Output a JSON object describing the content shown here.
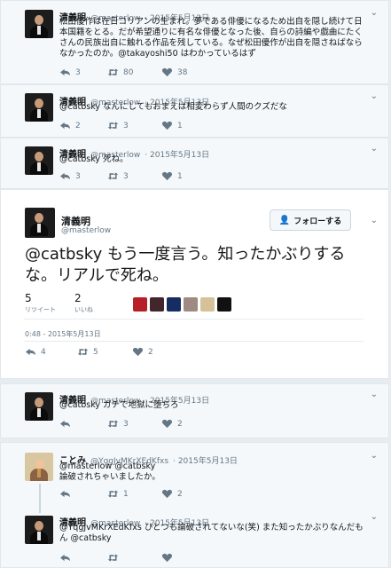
{
  "tweets": [
    {
      "name": "清義明",
      "handle": "@masterlow",
      "time": "· 2015年5月12日",
      "text": [
        "松田優作は在日コリアンの生まれ。夢である俳優になるため出自を隠し続けて日",
        "本国籍をとる。だが希望通りに有名な俳優となった後、自らの詩編や戯曲にたく",
        "さんの民族出自に触れる作品を残している。なぜ松田優作が出自を隠さねばなら",
        "なかったのか。@takayoshi50 はわかっているはず"
      ],
      "reply_count": "3",
      "retweet_count": "80",
      "like_count": "38"
    },
    {
      "name": "清義明",
      "handle": "@masterlow",
      "time": "· 2015年5月13日",
      "text": [
        "@catbsky なんにしてもおまえは相変わらず人間のクズだな"
      ],
      "reply_count": "2",
      "retweet_count": "3",
      "like_count": "1"
    },
    {
      "name": "清義明",
      "handle": "@masterlow",
      "time": "· 2015年5月13日",
      "text": [
        "@catbsky 死ね。"
      ],
      "reply_count": "3",
      "retweet_count": "3",
      "like_count": "1"
    }
  ],
  "main": {
    "name": "清義明",
    "handle": "@masterlow",
    "follow_label": "フォローする",
    "text": "@catbsky もう一度言う。知ったかぶりするな。リアルで死ね。",
    "retweets_num": "5",
    "retweets_label": "リツイート",
    "likes_num": "2",
    "likes_label": "いいね",
    "date": "0:48 - 2015年5月13日",
    "reply_count": "4",
    "retweet_count": "5",
    "like_count": "2"
  },
  "replies": [
    {
      "name": "清義明",
      "handle": "@masterlow",
      "time": "· 2015年5月13日",
      "text": [
        "@catbsky ガチで地獄に堕ちろ"
      ],
      "reply_count": "",
      "retweet_count": "3",
      "like_count": "2"
    },
    {
      "name": "ことみ",
      "handle": "@YqgJvMKrXEdKfxs",
      "time": "· 2015年5月13日",
      "text": [
        "@masterlow @catbsky",
        "論破されちゃいましたか。"
      ],
      "reply_count": "",
      "retweet_count": "1",
      "like_count": "2"
    },
    {
      "name": "清義明",
      "handle": "@masterlow",
      "time": "· 2015年5月13日",
      "text": [
        "@YqgJvMKrXEdKfxs ひとつも論破されてないな(笑) また知ったかぶりなんだも",
        "ん @catbsky"
      ],
      "reply_count": "",
      "retweet_count": "",
      "like_count": ""
    }
  ]
}
